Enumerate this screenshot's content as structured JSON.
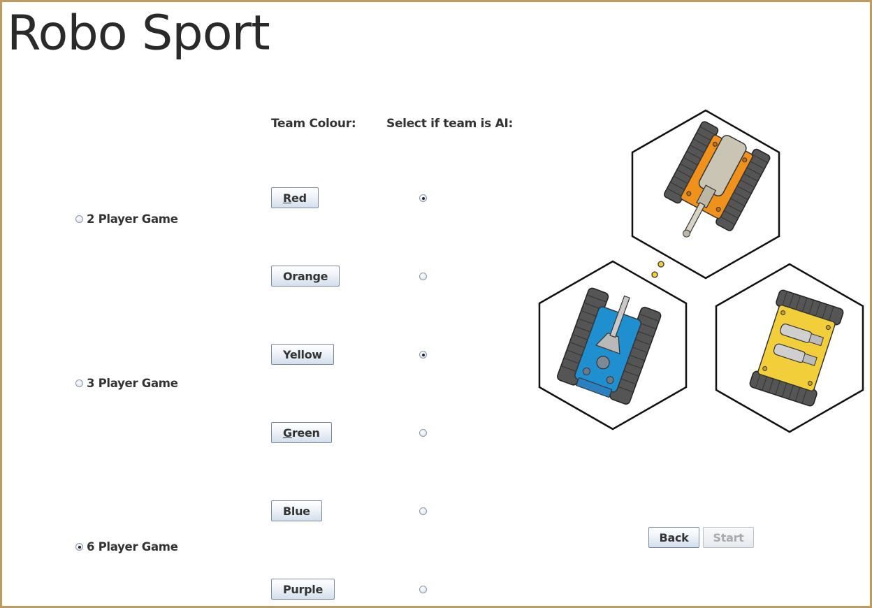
{
  "app": {
    "title": "Robo Sport"
  },
  "headers": {
    "team_colour": "Team Colour:",
    "ai_select": "Select if team is AI:"
  },
  "game_modes": [
    {
      "label": "2 Player Game",
      "selected": false
    },
    {
      "label": "3 Player Game",
      "selected": false
    },
    {
      "label": "6 Player Game",
      "selected": true
    }
  ],
  "teams": [
    {
      "label": "Red",
      "mnemonic": "R",
      "ai": true
    },
    {
      "label": "Orange",
      "mnemonic": "",
      "ai": false
    },
    {
      "label": "Yellow",
      "mnemonic": "",
      "ai": true
    },
    {
      "label": "Green",
      "mnemonic": "G",
      "ai": false
    },
    {
      "label": "Blue",
      "mnemonic": "",
      "ai": false
    },
    {
      "label": "Purple",
      "mnemonic": "",
      "ai": false
    }
  ],
  "actions": {
    "back": "Back",
    "start": "Start",
    "start_enabled": false
  },
  "colors": {
    "border": "#bf9a5e",
    "orange": "#f0911c",
    "blue": "#1f8fd0",
    "yellow": "#f2cf3a"
  },
  "illustration": {
    "hexes": [
      {
        "robot": "orange-tank",
        "icon": "orange-tank-icon"
      },
      {
        "robot": "blue-tank",
        "icon": "blue-tank-icon"
      },
      {
        "robot": "yellow-tank",
        "icon": "yellow-tank-icon"
      }
    ]
  }
}
